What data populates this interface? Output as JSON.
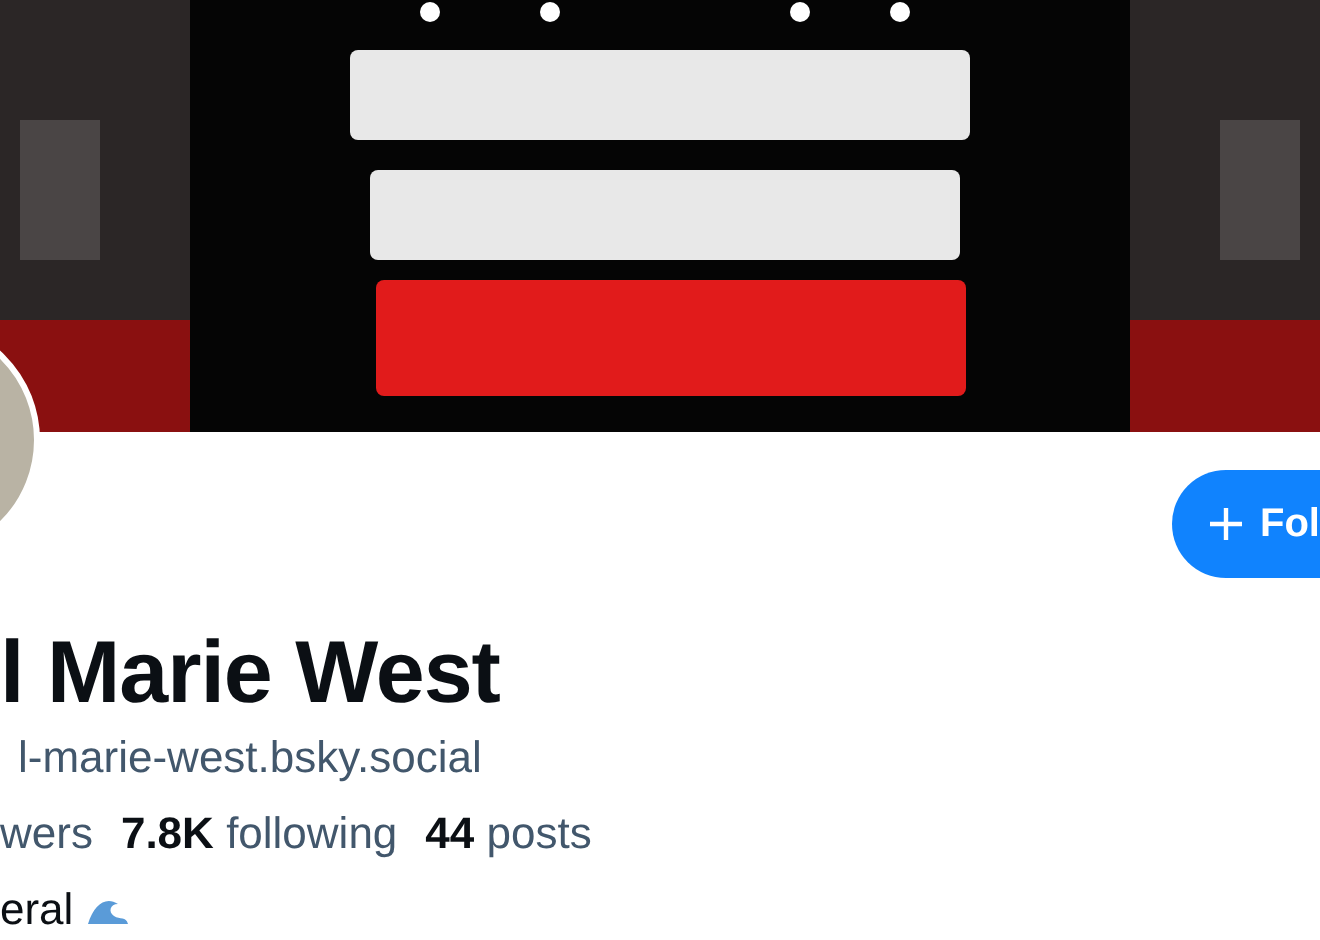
{
  "follow_button": {
    "label": "Fol"
  },
  "display_name": "l Marie West",
  "handle": "l-marie-west.bsky.social",
  "stats": [
    {
      "label": "wers"
    },
    {
      "count": "7.8K",
      "label": "following"
    },
    {
      "count": "44",
      "label": "posts"
    }
  ],
  "bio": "eral"
}
